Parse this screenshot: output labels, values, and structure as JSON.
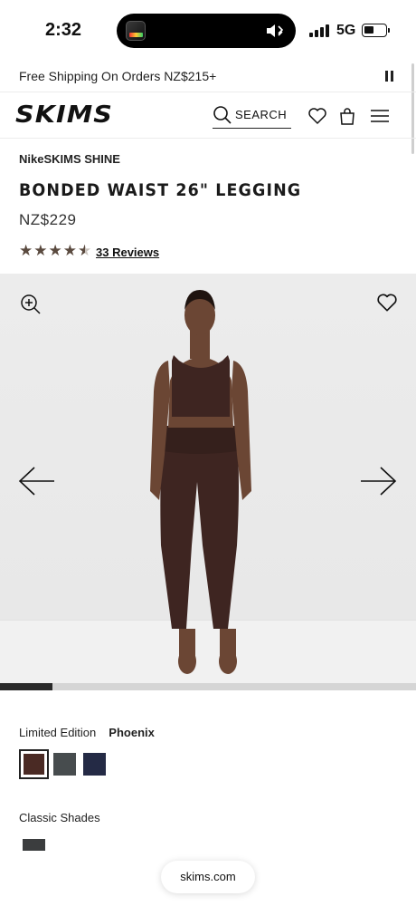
{
  "status_bar": {
    "time": "2:32",
    "network": "5G"
  },
  "announcement": {
    "text": "Free Shipping On Orders NZ$215+"
  },
  "header": {
    "logo": "SKIMS",
    "search_label": "SEARCH"
  },
  "product": {
    "collection": "NikeSKIMS SHINE",
    "title": "BONDED WAIST 26\" LEGGING",
    "price": "NZ$229",
    "rating": 4.5,
    "reviews_label": "33 Reviews"
  },
  "gallery": {
    "progress_fraction": 0.125
  },
  "variants": {
    "limited_label": "Limited Edition",
    "limited_selected": "Phoenix",
    "limited_swatches": [
      "#4a2a24",
      "#474c4e",
      "#242a45"
    ],
    "classic_label": "Classic Shades",
    "classic_swatches": [
      "#3b3d3e"
    ]
  },
  "browser": {
    "url": "skims.com"
  },
  "colors": {
    "text": "#1a1a1a",
    "star": "#5a4a3f",
    "progress": "#2a2a2a"
  }
}
